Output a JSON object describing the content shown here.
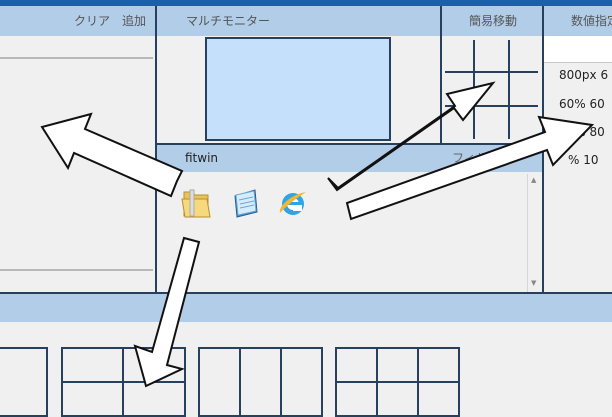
{
  "left_panel": {
    "clear_label": "クリア",
    "add_label": "追加"
  },
  "monitor_panel": {
    "title": "マルチモニター"
  },
  "simple_move_panel": {
    "title": "簡易移動"
  },
  "numeric_panel": {
    "title": "数値指定",
    "items": [
      "800px 6",
      "60% 60",
      "80% 80",
      "% 10"
    ]
  },
  "apps_panel": {
    "title": "fitwin",
    "filter_label": "フィルタ",
    "icons": [
      "folder-icon",
      "notepad-icon",
      "ie-icon"
    ]
  },
  "colors": {
    "header_bg": "#b1cde8",
    "border": "#27405e",
    "screen_fill": "#c5e0fa",
    "top_bar": "#1e5fa8"
  }
}
